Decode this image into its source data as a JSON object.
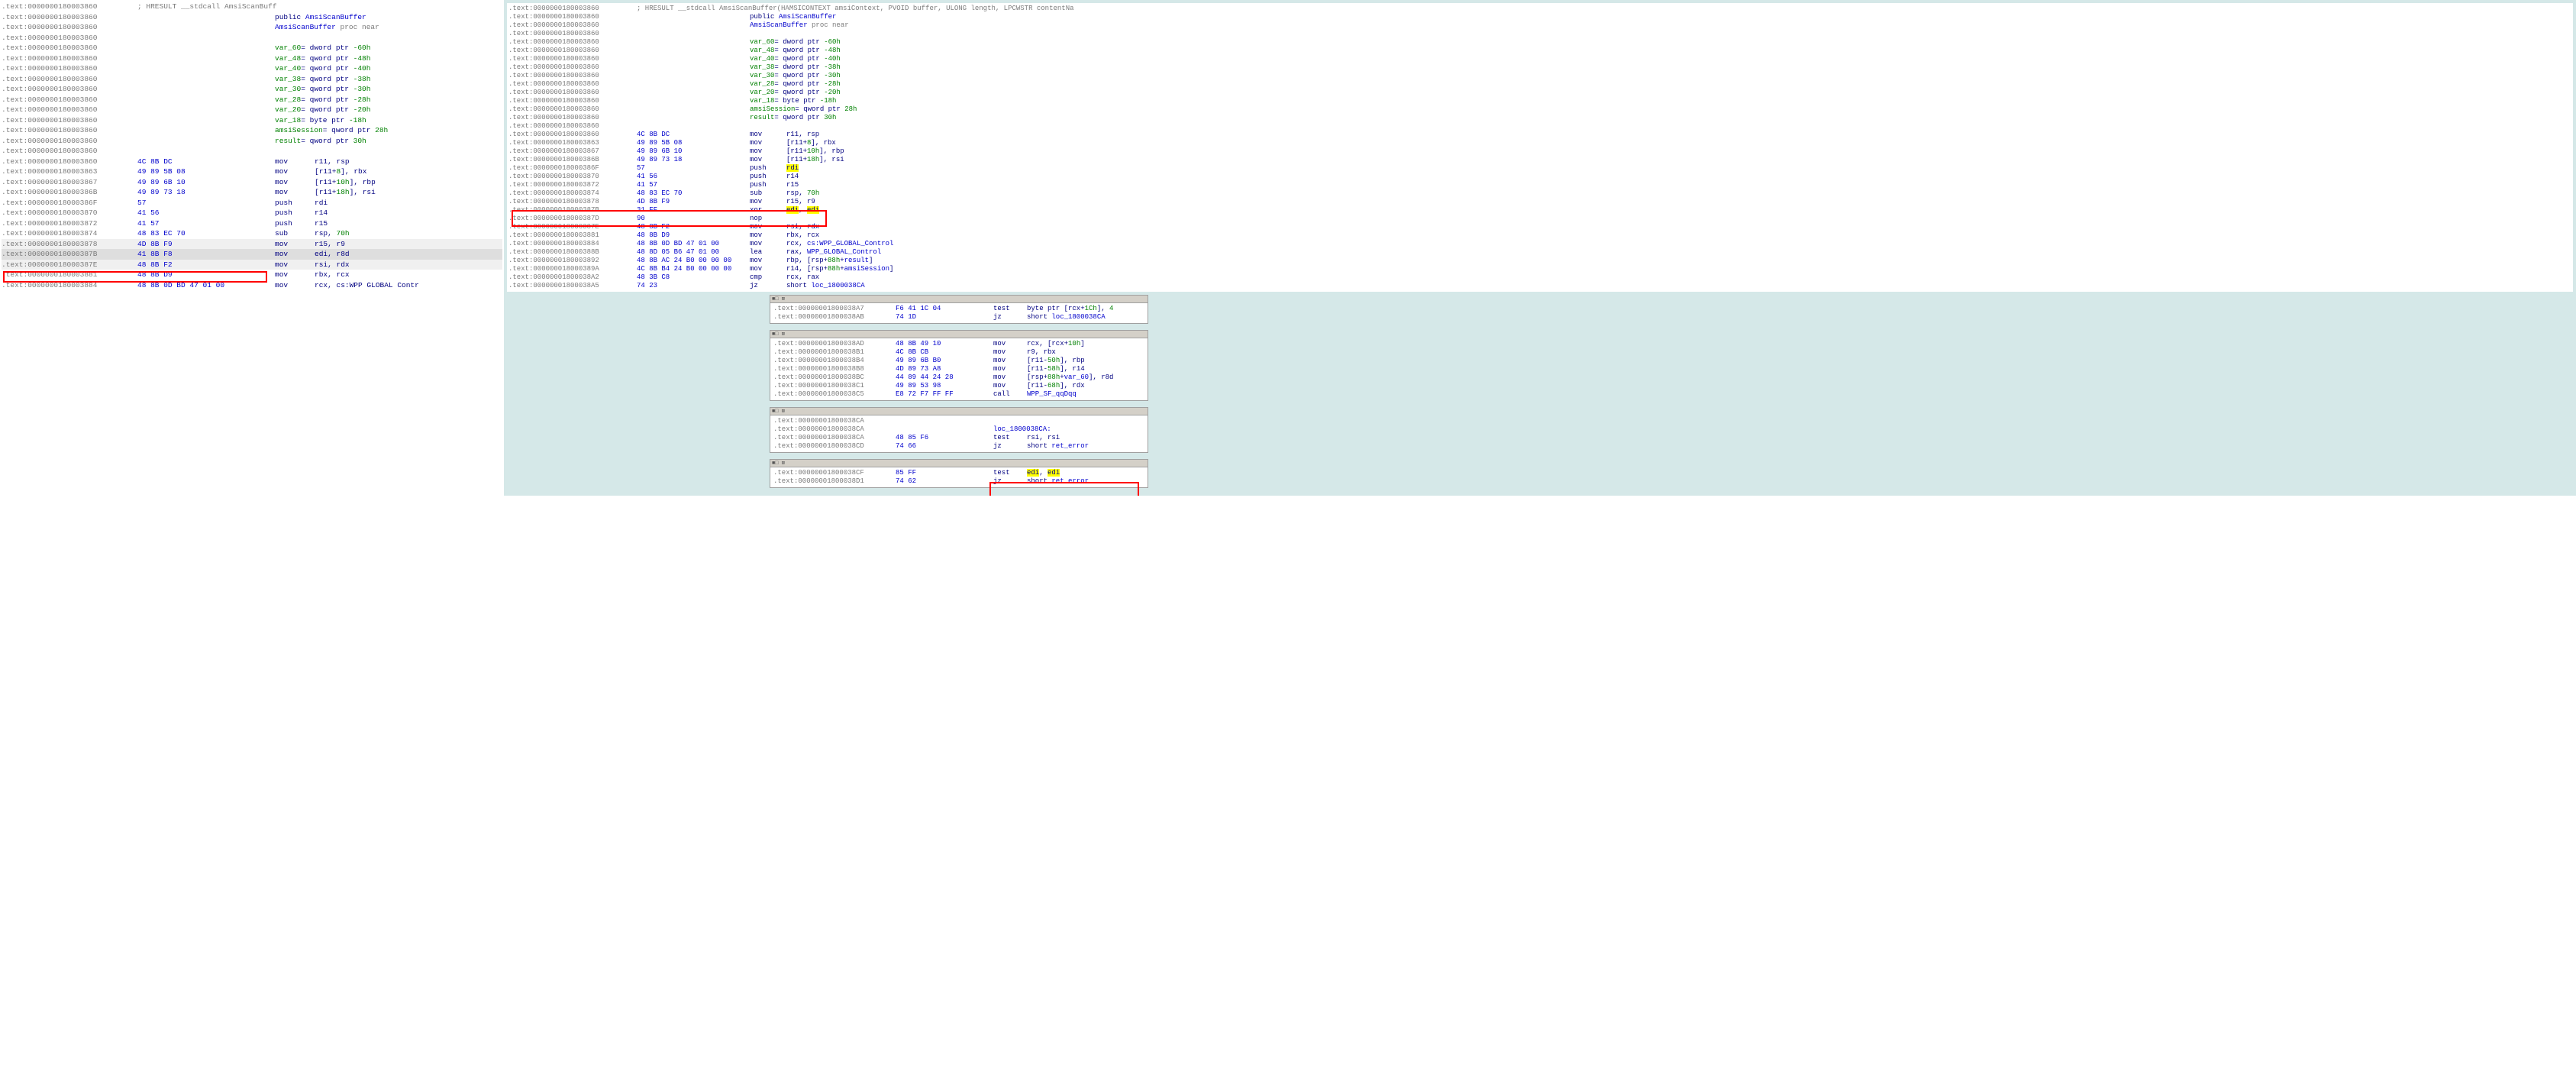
{
  "left": {
    "lines": [
      {
        "addr": ".text:0000000180003860",
        "cm": "; HRESULT __stdcall AmsiScanBuff"
      },
      {
        "addr": ".text:0000000180003860",
        "kw": "public",
        "ref": "AmsiScanBuffer"
      },
      {
        "addr": ".text:0000000180003860",
        "ref": "AmsiScanBuffer",
        "tail": " proc near"
      },
      {
        "addr": ".text:0000000180003860",
        "blank": true
      },
      {
        "addr": ".text:0000000180003860",
        "var": "var_60",
        "tail": "= dword ptr ",
        "num": "-60h"
      },
      {
        "addr": ".text:0000000180003860",
        "var": "var_48",
        "tail": "= qword ptr ",
        "num": "-48h"
      },
      {
        "addr": ".text:0000000180003860",
        "var": "var_40",
        "tail": "= qword ptr ",
        "num": "-40h"
      },
      {
        "addr": ".text:0000000180003860",
        "var": "var_38",
        "tail": "= qword ptr ",
        "num": "-38h"
      },
      {
        "addr": ".text:0000000180003860",
        "var": "var_30",
        "tail": "= qword ptr ",
        "num": "-30h"
      },
      {
        "addr": ".text:0000000180003860",
        "var": "var_28",
        "tail": "= qword ptr ",
        "num": "-28h"
      },
      {
        "addr": ".text:0000000180003860",
        "var": "var_20",
        "tail": "= qword ptr ",
        "num": "-20h"
      },
      {
        "addr": ".text:0000000180003860",
        "var": "var_18",
        "tail": "= byte ptr ",
        "num": "-18h"
      },
      {
        "addr": ".text:0000000180003860",
        "var": "amsiSession",
        "tail": "= qword ptr  ",
        "num": "28h"
      },
      {
        "addr": ".text:0000000180003860",
        "var": "result",
        "tail": "= qword ptr  ",
        "num": "30h"
      },
      {
        "addr": ".text:0000000180003860",
        "blank": true
      },
      {
        "addr": ".text:0000000180003860",
        "bytes": "4C 8B DC",
        "mn": "mov",
        "op": "r11, rsp"
      },
      {
        "addr": ".text:0000000180003863",
        "bytes": "49 89 5B 08",
        "mn": "mov",
        "op": "[r11+",
        "num": "8",
        "op2": "], rbx"
      },
      {
        "addr": ".text:0000000180003867",
        "bytes": "49 89 6B 10",
        "mn": "mov",
        "op": "[r11+",
        "num": "10h",
        "op2": "], rbp"
      },
      {
        "addr": ".text:000000018000386B",
        "bytes": "49 89 73 18",
        "mn": "mov",
        "op": "[r11+",
        "num": "18h",
        "op2": "], rsi"
      },
      {
        "addr": ".text:000000018000386F",
        "bytes": "57",
        "mn": "push",
        "op": "rdi"
      },
      {
        "addr": ".text:0000000180003870",
        "bytes": "41 56",
        "mn": "push",
        "op": "r14"
      },
      {
        "addr": ".text:0000000180003872",
        "bytes": "41 57",
        "mn": "push",
        "op": "r15"
      },
      {
        "addr": ".text:0000000180003874",
        "bytes": "48 83 EC 70",
        "mn": "sub",
        "op": "rsp, ",
        "num": "70h"
      },
      {
        "addr": ".text:0000000180003878",
        "bytes": "4D 8B F9",
        "mn": "mov",
        "op": "r15, r9",
        "faded": true
      },
      {
        "addr": ".text:000000018000387B",
        "bytes": "41 8B F8",
        "mn": "mov",
        "op": "edi, r8d",
        "sel": true,
        "red": true
      },
      {
        "addr": ".text:000000018000387E",
        "bytes": "48 8B F2",
        "mn": "mov",
        "op": "rsi, rdx",
        "faded": true
      },
      {
        "addr": ".text:0000000180003881",
        "bytes": "48 8B D9",
        "mn": "mov",
        "op": "rbx, rcx"
      },
      {
        "addr": ".text:0000000180003884",
        "bytes": "48 8B 0D BD 47 01 00",
        "mn": "mov",
        "op": "rcx, cs:WPP GLOBAL Contr"
      }
    ]
  },
  "right": {
    "lines": [
      {
        "addr": ".text:0000000180003860",
        "cm": "; HRESULT __stdcall AmsiScanBuffer(HAMSICONTEXT amsiContext, PVOID buffer, ULONG length, LPCWSTR contentNa"
      },
      {
        "addr": ".text:0000000180003860",
        "kw": "public",
        "ref": "AmsiScanBuffer"
      },
      {
        "addr": ".text:0000000180003860",
        "ref": "AmsiScanBuffer",
        "tail": " proc near"
      },
      {
        "addr": ".text:0000000180003860",
        "blank": true
      },
      {
        "addr": ".text:0000000180003860",
        "var": "var_60",
        "tail": "= dword ptr ",
        "num": "-60h"
      },
      {
        "addr": ".text:0000000180003860",
        "var": "var_48",
        "tail": "= qword ptr ",
        "num": "-48h"
      },
      {
        "addr": ".text:0000000180003860",
        "var": "var_40",
        "tail": "= qword ptr ",
        "num": "-40h"
      },
      {
        "addr": ".text:0000000180003860",
        "var": "var_38",
        "tail": "= dword ptr ",
        "num": "-38h"
      },
      {
        "addr": ".text:0000000180003860",
        "var": "var_30",
        "tail": "= qword ptr ",
        "num": "-30h"
      },
      {
        "addr": ".text:0000000180003860",
        "var": "var_28",
        "tail": "= qword ptr ",
        "num": "-28h"
      },
      {
        "addr": ".text:0000000180003860",
        "var": "var_20",
        "tail": "= qword ptr ",
        "num": "-20h"
      },
      {
        "addr": ".text:0000000180003860",
        "var": "var_18",
        "tail": "= byte ptr ",
        "num": "-18h"
      },
      {
        "addr": ".text:0000000180003860",
        "var": "amsiSession",
        "tail": "= qword ptr  ",
        "num": "28h"
      },
      {
        "addr": ".text:0000000180003860",
        "var": "result",
        "tail": "= qword ptr  ",
        "num": "30h"
      },
      {
        "addr": ".text:0000000180003860",
        "blank": true
      },
      {
        "addr": ".text:0000000180003860",
        "bytes": "4C 8B DC",
        "mn": "mov",
        "op": "r11, rsp"
      },
      {
        "addr": ".text:0000000180003863",
        "bytes": "49 89 5B 08",
        "mn": "mov",
        "op": "[r11+",
        "num": "8",
        "op2": "], rbx"
      },
      {
        "addr": ".text:0000000180003867",
        "bytes": "49 89 6B 10",
        "mn": "mov",
        "op": "[r11+",
        "num": "10h",
        "op2": "], rbp"
      },
      {
        "addr": ".text:000000018000386B",
        "bytes": "49 89 73 18",
        "mn": "mov",
        "op": "[r11+",
        "num": "18h",
        "op2": "], rsi"
      },
      {
        "addr": ".text:000000018000386F",
        "bytes": "57",
        "mn": "push",
        "op_hl": "rdi"
      },
      {
        "addr": ".text:0000000180003870",
        "bytes": "41 56",
        "mn": "push",
        "op": "r14"
      },
      {
        "addr": ".text:0000000180003872",
        "bytes": "41 57",
        "mn": "push",
        "op": "r15"
      },
      {
        "addr": ".text:0000000180003874",
        "bytes": "48 83 EC 70",
        "mn": "sub",
        "op": "rsp, ",
        "num": "70h"
      },
      {
        "addr": ".text:0000000180003878",
        "bytes": "4D 8B F9",
        "mn": "mov",
        "op": "r15, r9"
      },
      {
        "addr": ".text:000000018000387B",
        "bytes": "31 FF",
        "mn": "xor",
        "op_hl2": "edi, edi"
      },
      {
        "addr": ".text:000000018000387D",
        "bytes": "90",
        "mn": "nop"
      },
      {
        "addr": ".text:000000018000387E",
        "bytes": "48 8B F2",
        "mn": "mov",
        "op": "rsi, rdx"
      },
      {
        "addr": ".text:0000000180003881",
        "bytes": "48 8B D9",
        "mn": "mov",
        "op": "rbx, rcx"
      },
      {
        "addr": ".text:0000000180003884",
        "bytes": "48 8B 0D BD 47 01 00",
        "mn": "mov",
        "op": "rcx, ",
        "ref": "cs:WPP_GLOBAL_Control"
      },
      {
        "addr": ".text:000000018000388B",
        "bytes": "48 8D 05 B6 47 01 00",
        "mn": "lea",
        "op": "rax, ",
        "ref": "WPP_GLOBAL_Control"
      },
      {
        "addr": ".text:0000000180003892",
        "bytes": "48 8B AC 24 B0 00 00 00",
        "mn": "mov",
        "op": "rbp, [rsp+",
        "num": "88h",
        "op2": "+",
        "ref": "result",
        "op3": "]"
      },
      {
        "addr": ".text:000000018000389A",
        "bytes": "4C 8B B4 24 B0 00 00 00",
        "mn": "mov",
        "op": "r14, [rsp+",
        "num": "88h",
        "op2": "+",
        "ref": "amsiSession",
        "op3": "]"
      },
      {
        "addr": ".text:00000001800038A2",
        "bytes": "48 3B C8",
        "mn": "cmp",
        "op": "rcx, rax"
      },
      {
        "addr": ".text:00000001800038A5",
        "bytes": "74 23",
        "mn": "jz",
        "op": "short ",
        "ref": "loc_1800038CA"
      }
    ],
    "box1": {
      "lines": [
        {
          "addr": ".text:00000001800038A7",
          "bytes": "F6 41 1C 04",
          "mn": "test",
          "op": "byte ptr [rcx+",
          "num": "1Ch",
          "op2": "], ",
          "num2": "4"
        },
        {
          "addr": ".text:00000001800038AB",
          "bytes": "74 1D",
          "mn": "jz",
          "op": "short ",
          "ref": "loc_1800038CA"
        }
      ]
    },
    "box2": {
      "lines": [
        {
          "addr": ".text:00000001800038AD",
          "bytes": "48 8B 49 10",
          "mn": "mov",
          "op": "rcx, [rcx+",
          "num": "10h",
          "op2": "]"
        },
        {
          "addr": ".text:00000001800038B1",
          "bytes": "4C 8B CB",
          "mn": "mov",
          "op": "r9, rbx"
        },
        {
          "addr": ".text:00000001800038B4",
          "bytes": "49 89 6B B0",
          "mn": "mov",
          "op": "[r11-",
          "num": "50h",
          "op2": "], rbp"
        },
        {
          "addr": ".text:00000001800038B8",
          "bytes": "4D 89 73 A8",
          "mn": "mov",
          "op": "[r11-",
          "num": "58h",
          "op2": "], r14"
        },
        {
          "addr": ".text:00000001800038BC",
          "bytes": "44 89 44 24 28",
          "mn": "mov",
          "op": "[rsp+",
          "num": "88h",
          "op2": "+",
          "ref": "var_60",
          "op3": "], r8d"
        },
        {
          "addr": ".text:00000001800038C1",
          "bytes": "49 89 53 98",
          "mn": "mov",
          "op": "[r11-",
          "num": "68h",
          "op2": "], rdx"
        },
        {
          "addr": ".text:00000001800038C5",
          "bytes": "E8 72 F7 FF FF",
          "mn": "call",
          "ref": "WPP_SF_qqDqq"
        }
      ]
    },
    "box3": {
      "lines": [
        {
          "addr": ".text:00000001800038CA",
          "blank": true
        },
        {
          "addr": ".text:00000001800038CA",
          "label": "loc_1800038CA:"
        },
        {
          "addr": ".text:00000001800038CA",
          "bytes": "48 85 F6",
          "mn": "test",
          "op": "rsi, rsi"
        },
        {
          "addr": ".text:00000001800038CD",
          "bytes": "74 66",
          "mn": "jz",
          "op": "short ",
          "ref": "ret_error"
        }
      ]
    },
    "box4": {
      "lines": [
        {
          "addr": ".text:00000001800038CF",
          "bytes": "85 FF",
          "mn": "test",
          "op_hl2": "edi, edi"
        },
        {
          "addr": ".text:00000001800038D1",
          "bytes": "74 62",
          "mn": "jz",
          "op": "short ",
          "ref": "ret_error"
        }
      ]
    }
  },
  "box_title": "■□ ⊠"
}
